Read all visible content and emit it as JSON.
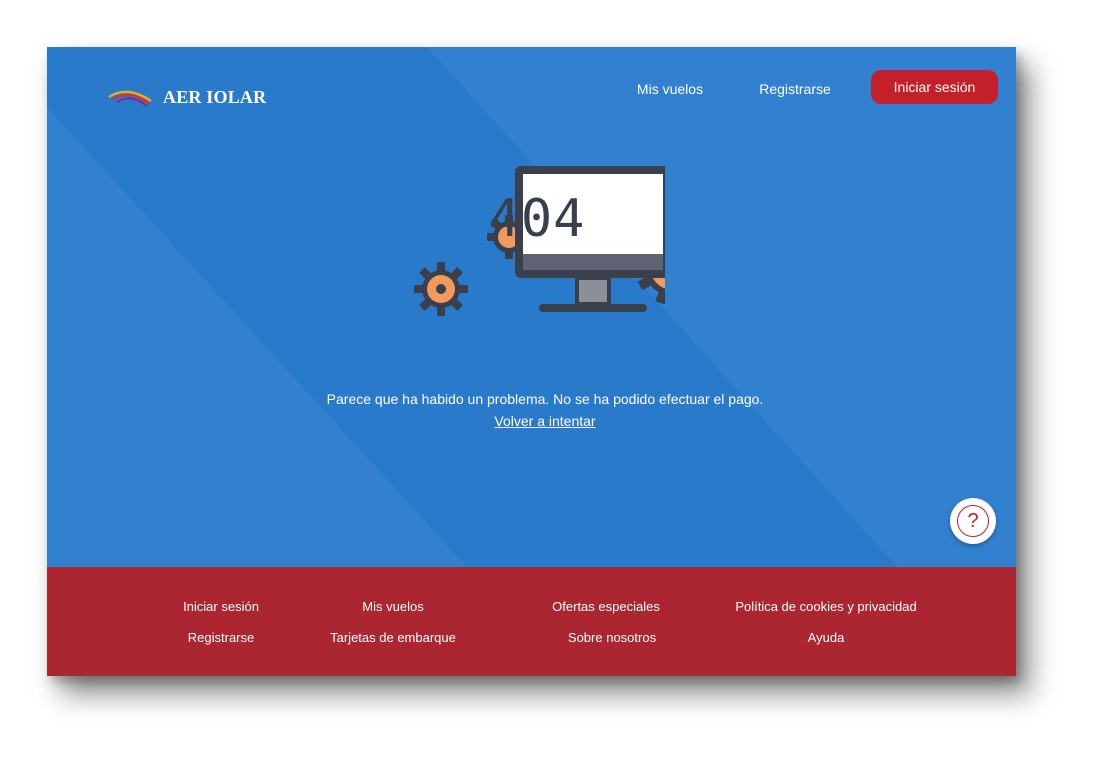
{
  "brand": {
    "name": "AER IOLAR"
  },
  "nav": {
    "mis_vuelos": "Mis vuelos",
    "registrarse": "Registrarse",
    "login": "Iniciar sesión"
  },
  "error": {
    "code": "404",
    "message": "Parece que ha habido un problema. No se ha podido efectuar el pago.",
    "retry": "Volver a intentar"
  },
  "help": {
    "icon": "question-icon",
    "glyph": "?"
  },
  "footer": {
    "links": [
      "Iniciar sesión",
      "Mis vuelos",
      "Ofertas especiales",
      "Política de cookies y privacidad",
      "Registrarse",
      "Tarjetas de embarque",
      "Sobre nosotros",
      "Ayuda"
    ]
  },
  "colors": {
    "hero_blue": "#2a7acb",
    "brand_red": "#c4202a",
    "footer_red": "#ab2630",
    "gear_orange": "#f29a5c"
  }
}
